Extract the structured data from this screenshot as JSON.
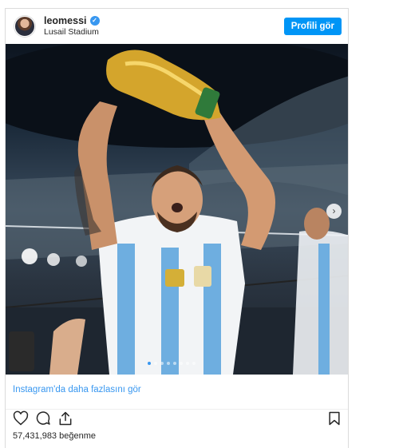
{
  "post": {
    "username": "leomessi",
    "location": "Lusail Stadium",
    "profile_button": "Profili gör",
    "more_link": "Instagram'da daha fazlasını gör",
    "likes": "57,431,983 beğenme"
  },
  "icons": {
    "verified": "verified-badge-icon",
    "next": "chevron-right-icon",
    "like": "heart-icon",
    "comment": "comment-icon",
    "share": "share-icon",
    "save": "bookmark-icon"
  },
  "colors": {
    "accent": "#0095f6",
    "link": "#3897f0",
    "text": "#262626",
    "border": "#dbdbdb"
  },
  "carousel": {
    "slide_count": 8,
    "active_index": 0
  }
}
